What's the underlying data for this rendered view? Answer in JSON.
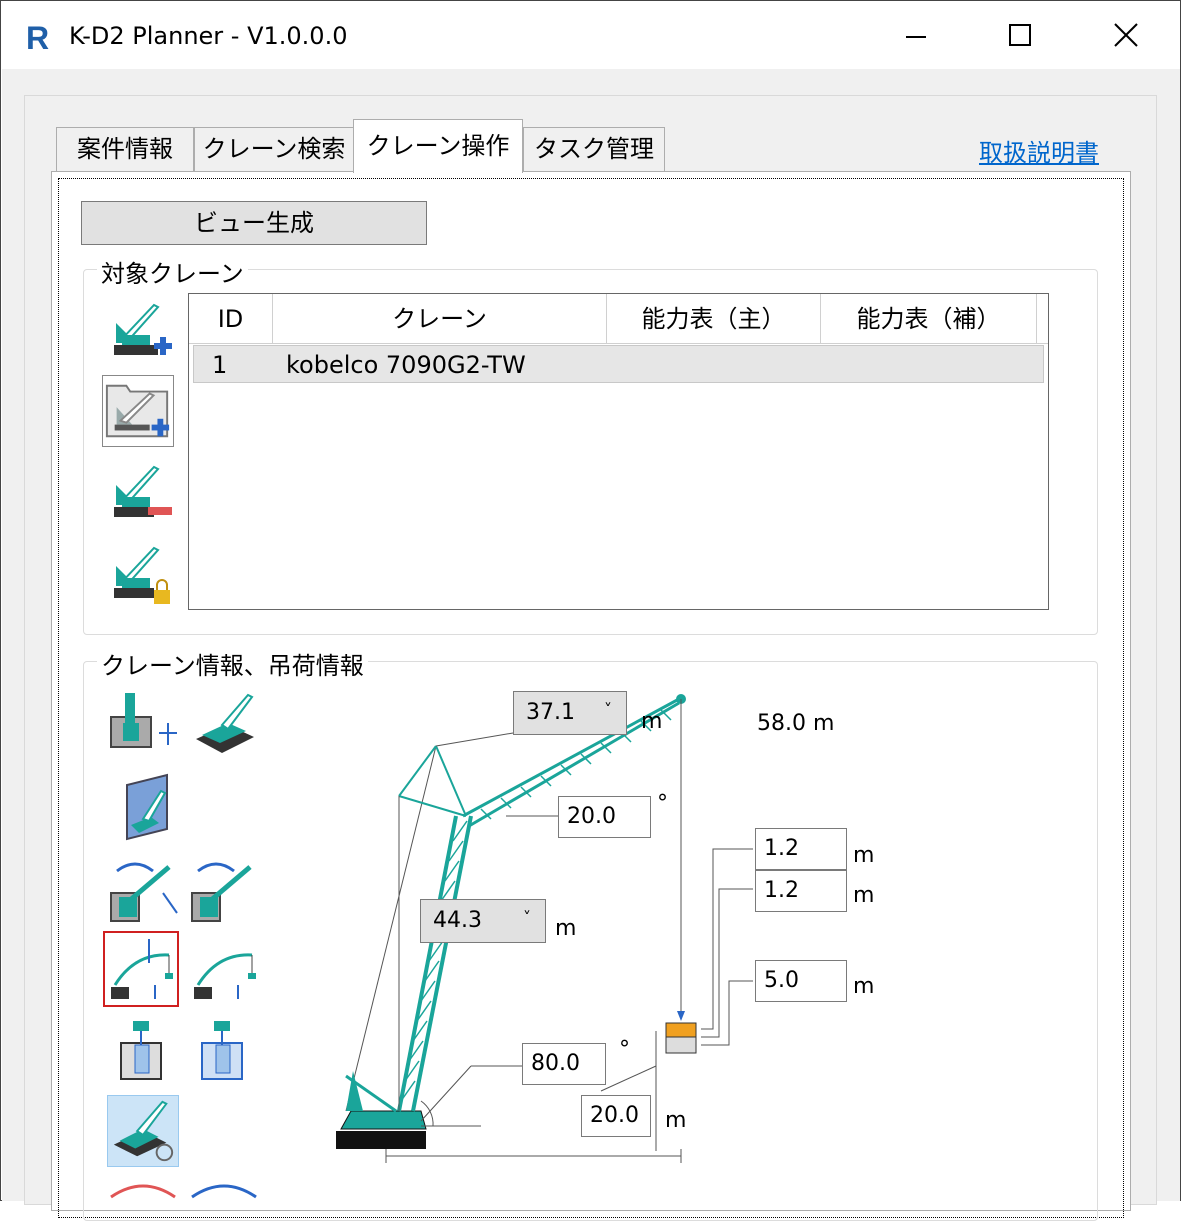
{
  "window": {
    "title": "K-D2 Planner - V1.0.0.0",
    "app_icon_letter": "R",
    "minimize_glyph": "—",
    "maximize_glyph": "☐",
    "close_glyph": "✕"
  },
  "tabs": [
    {
      "label": "案件情報",
      "active": false
    },
    {
      "label": "クレーン検索",
      "active": false
    },
    {
      "label": "クレーン操作",
      "active": true
    },
    {
      "label": "タスク管理",
      "active": false
    }
  ],
  "help_link": "取扱説明書",
  "view_button": "ビュー生成",
  "target_crane": {
    "group_label": "対象クレーン",
    "icons": [
      "crane-add-icon",
      "crane-folder-add-icon",
      "crane-remove-icon",
      "crane-lock-icon"
    ],
    "columns": [
      "ID",
      "クレーン",
      "能力表（主）",
      "能力表（補）"
    ],
    "rows": [
      {
        "id": "1",
        "crane": "kobelco 7090G2-TW",
        "main_table": "",
        "aux_table": ""
      }
    ]
  },
  "crane_info": {
    "group_label": "クレーン情報、吊荷情報",
    "jib_length": "37.1",
    "jib_unit": "m",
    "total_height": "58.0 m",
    "jib_angle": "20.0",
    "jib_angle_unit": "°",
    "boom_length": "44.3",
    "boom_unit": "m",
    "load_dim_1": "1.2",
    "load_dim_1_unit": "m",
    "load_dim_2": "1.2",
    "load_dim_2_unit": "m",
    "load_dim_3": "5.0",
    "load_dim_3_unit": "m",
    "boom_angle": "80.0",
    "boom_angle_unit": "°",
    "radius": "20.0",
    "radius_unit": "m",
    "accent_color": "#1aa59a"
  }
}
